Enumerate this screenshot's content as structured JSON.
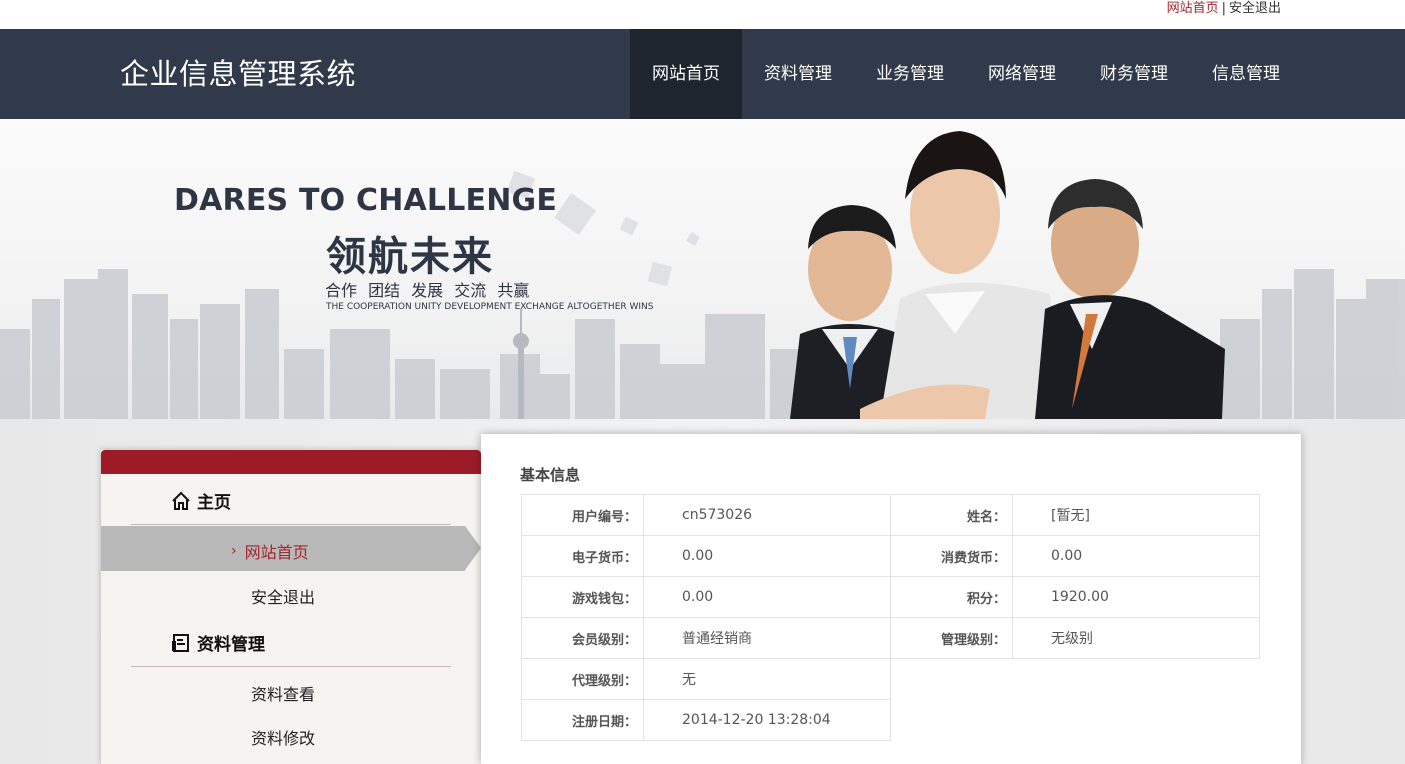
{
  "topbar": {
    "home_link": "网站首页",
    "separator": "|",
    "logout_link": "安全退出"
  },
  "header": {
    "title": "企业信息管理系统",
    "nav": [
      {
        "label": "网站首页",
        "active": true
      },
      {
        "label": "资料管理",
        "active": false
      },
      {
        "label": "业务管理",
        "active": false
      },
      {
        "label": "网络管理",
        "active": false
      },
      {
        "label": "财务管理",
        "active": false
      },
      {
        "label": "信息管理",
        "active": false
      }
    ]
  },
  "banner": {
    "headline_en": "DARES TO CHALLENGE",
    "headline_cn": "领航未来",
    "subline": "合作 团结 发展 交流 共赢",
    "tagline": "THE COOPERATION UNITY DEVELOPMENT EXCHANGE ALTOGETHER WINS"
  },
  "sidebar": {
    "section_home": {
      "icon": "home-icon",
      "label": "主页"
    },
    "home_links": [
      {
        "label": "网站首页",
        "active": true
      },
      {
        "label": "安全退出",
        "active": false
      }
    ],
    "section_profile": {
      "icon": "document-icon",
      "label": "资料管理"
    },
    "profile_links": [
      {
        "label": "资料查看"
      },
      {
        "label": "资料修改"
      }
    ],
    "active_marker": "›"
  },
  "panel": {
    "title": "基本信息",
    "rows": [
      {
        "l1": "用户编号：",
        "v1": "cn573026",
        "l2": "姓名：",
        "v2": "[暂无]"
      },
      {
        "l1": "电子货币：",
        "v1": "0.00",
        "l2": "消费货币：",
        "v2": "0.00"
      },
      {
        "l1": "游戏钱包：",
        "v1": "0.00",
        "l2": "积分：",
        "v2": "1920.00"
      },
      {
        "l1": "会员级别：",
        "v1": "普通经销商",
        "l2": "管理级别：",
        "v2": "无级别"
      },
      {
        "l1": "代理级别：",
        "v1": "无"
      },
      {
        "l1": "注册日期：",
        "v1": "2014-12-20 13:28:04"
      }
    ]
  },
  "colors": {
    "header_bg": "#313a4a",
    "accent_red": "#9d1b27",
    "link_red": "#a3252e"
  }
}
